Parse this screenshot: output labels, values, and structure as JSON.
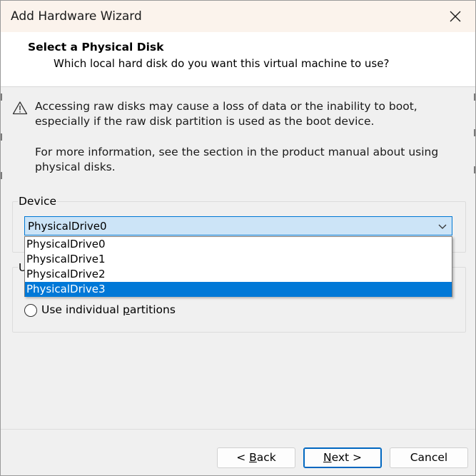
{
  "window": {
    "title": "Add Hardware Wizard"
  },
  "header": {
    "title": "Select a Physical Disk",
    "subtitle": "Which local hard disk do you want this virtual machine to use?"
  },
  "warning": {
    "text": "Accessing raw disks may cause a loss of data or the inability to boot, especially if the raw disk partition is used as the boot device.",
    "info": "For more information, see the section in the product manual about using physical disks."
  },
  "device": {
    "label": "Device",
    "selected": "PhysicalDrive0",
    "options": [
      "PhysicalDrive0",
      "PhysicalDrive1",
      "PhysicalDrive2",
      "PhysicalDrive3"
    ],
    "highlighted": "PhysicalDrive3"
  },
  "usage": {
    "label": "U",
    "radio_label_before": "Use individual ",
    "radio_label_underline": "p",
    "radio_label_after": "artitions"
  },
  "buttons": {
    "back_prefix": "< ",
    "back_key": "B",
    "back_rest": "ack",
    "next_key": "N",
    "next_rest": "ext >",
    "cancel": "Cancel"
  },
  "colors": {
    "accent": "#0078d7",
    "combo_bg": "#cce4f7",
    "titlebar_bg": "#fbf3ec"
  }
}
